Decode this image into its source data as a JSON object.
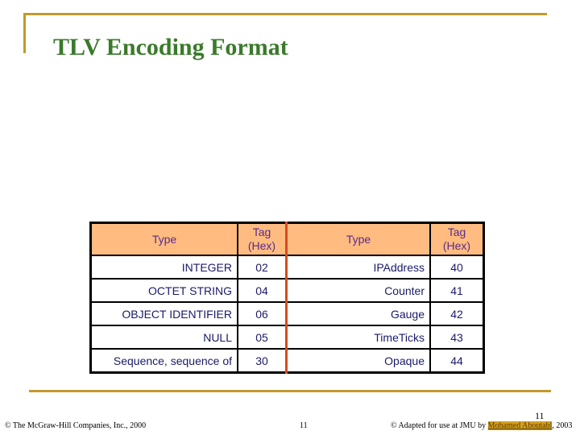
{
  "slide": {
    "title": "TLV Encoding Format",
    "page_number": "11"
  },
  "table": {
    "headers": {
      "type_left": "Type",
      "tag_left_line1": "Tag",
      "tag_left_line2": "(Hex)",
      "type_right": "Type",
      "tag_right_line1": "Tag",
      "tag_right_line2": "(Hex)"
    },
    "rows": [
      {
        "type_left": "INTEGER",
        "tag_left": "02",
        "type_right": "IPAddress",
        "tag_right": "40"
      },
      {
        "type_left": "OCTET STRING",
        "tag_left": "04",
        "type_right": "Counter",
        "tag_right": "41"
      },
      {
        "type_left": "OBJECT IDENTIFIER",
        "tag_left": "06",
        "type_right": "Gauge",
        "tag_right": "42"
      },
      {
        "type_left": "NULL",
        "tag_left": "05",
        "type_right": "TimeTicks",
        "tag_right": "43"
      },
      {
        "type_left": "Sequence, sequence of",
        "tag_left": "30",
        "type_right": "Opaque",
        "tag_right": "44"
      }
    ]
  },
  "footer": {
    "left": "© The McGraw-Hill Companies, Inc., 2000",
    "middle": "11",
    "right_prefix": "© Adapted for use at JMU by ",
    "right_author": "Mohamed Aboutabl",
    "right_suffix": ", 2003"
  },
  "colors": {
    "accent_gold": "#c09a2a",
    "title_green": "#3a7a2a",
    "header_fill": "#ffbb80",
    "separator_red": "#d84a1c"
  }
}
